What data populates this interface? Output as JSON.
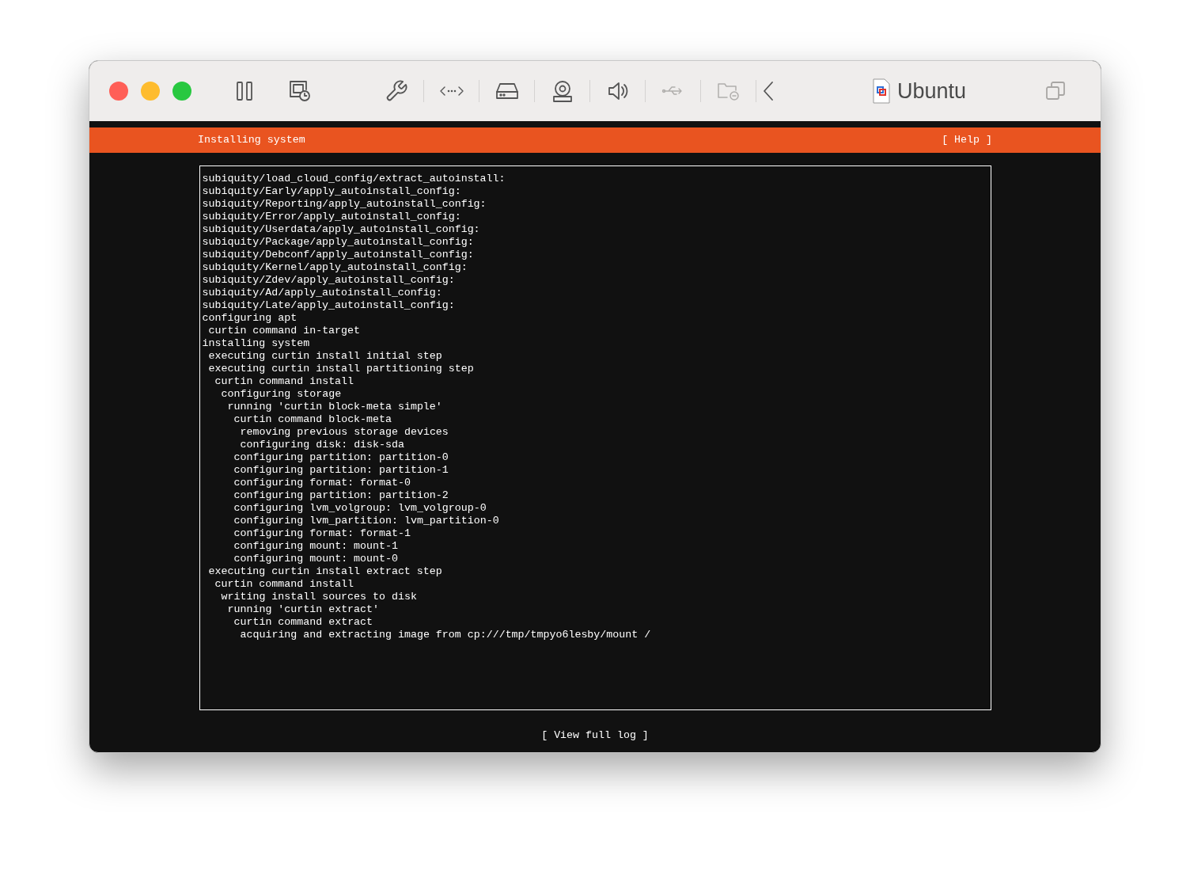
{
  "window": {
    "title": "Ubuntu"
  },
  "toolbar": {
    "controls": [
      {
        "kind": "pause"
      },
      {
        "kind": "screenshot"
      }
    ],
    "devices": [
      {
        "kind": "settings",
        "disabled": false
      },
      {
        "kind": "network",
        "disabled": false
      },
      {
        "kind": "drive",
        "disabled": false
      },
      {
        "kind": "camera",
        "disabled": false
      },
      {
        "kind": "sound",
        "disabled": false
      },
      {
        "kind": "usb",
        "disabled": true
      },
      {
        "kind": "shared-folder",
        "disabled": true
      },
      {
        "kind": "collapse",
        "disabled": false
      }
    ]
  },
  "installer": {
    "title": "Installing system",
    "help": "[ Help ]",
    "log": [
      {
        "text": "subiquity/load_cloud_config/extract_autoinstall:"
      },
      {
        "text": "subiquity/Early/apply_autoinstall_config:"
      },
      {
        "text": "subiquity/Reporting/apply_autoinstall_config:"
      },
      {
        "text": "subiquity/Error/apply_autoinstall_config:"
      },
      {
        "text": "subiquity/Userdata/apply_autoinstall_config:"
      },
      {
        "text": "subiquity/Package/apply_autoinstall_config:"
      },
      {
        "text": "subiquity/Debconf/apply_autoinstall_config:"
      },
      {
        "text": "subiquity/Kernel/apply_autoinstall_config:"
      },
      {
        "text": "subiquity/Zdev/apply_autoinstall_config:"
      },
      {
        "text": "subiquity/Ad/apply_autoinstall_config:"
      },
      {
        "text": "subiquity/Late/apply_autoinstall_config:"
      },
      {
        "text": "configuring apt",
        "children": [
          {
            "text": "curtin command in-target"
          }
        ]
      },
      {
        "text": "installing system",
        "children": [
          {
            "text": "executing curtin install initial step"
          },
          {
            "text": "executing curtin install partitioning step",
            "children": [
              {
                "text": "curtin command install",
                "children": [
                  {
                    "text": "configuring storage",
                    "children": [
                      {
                        "text": "running 'curtin block-meta simple'",
                        "children": [
                          {
                            "text": "curtin command block-meta",
                            "children": [
                              {
                                "text": "removing previous storage devices"
                              },
                              {
                                "text": "configuring disk: disk-sda"
                              }
                            ]
                          },
                          {
                            "text": "configuring partition: partition-0"
                          },
                          {
                            "text": "configuring partition: partition-1"
                          },
                          {
                            "text": "configuring format: format-0"
                          },
                          {
                            "text": "configuring partition: partition-2"
                          },
                          {
                            "text": "configuring lvm_volgroup: lvm_volgroup-0"
                          },
                          {
                            "text": "configuring lvm_partition: lvm_partition-0"
                          },
                          {
                            "text": "configuring format: format-1"
                          },
                          {
                            "text": "configuring mount: mount-1"
                          },
                          {
                            "text": "configuring mount: mount-0"
                          }
                        ]
                      }
                    ]
                  }
                ]
              }
            ]
          },
          {
            "text": "executing curtin install extract step",
            "children": [
              {
                "text": "curtin command install",
                "children": [
                  {
                    "text": "writing install sources to disk",
                    "children": [
                      {
                        "text": "running 'curtin extract'",
                        "children": [
                          {
                            "text": "curtin command extract",
                            "children": [
                              {
                                "text": "acquiring and extracting image from cp:///tmp/tmpyo6lesby/mount /"
                              }
                            ]
                          }
                        ]
                      }
                    ]
                  }
                ]
              }
            ]
          }
        ]
      }
    ],
    "view_log": "[ View full log ]"
  }
}
